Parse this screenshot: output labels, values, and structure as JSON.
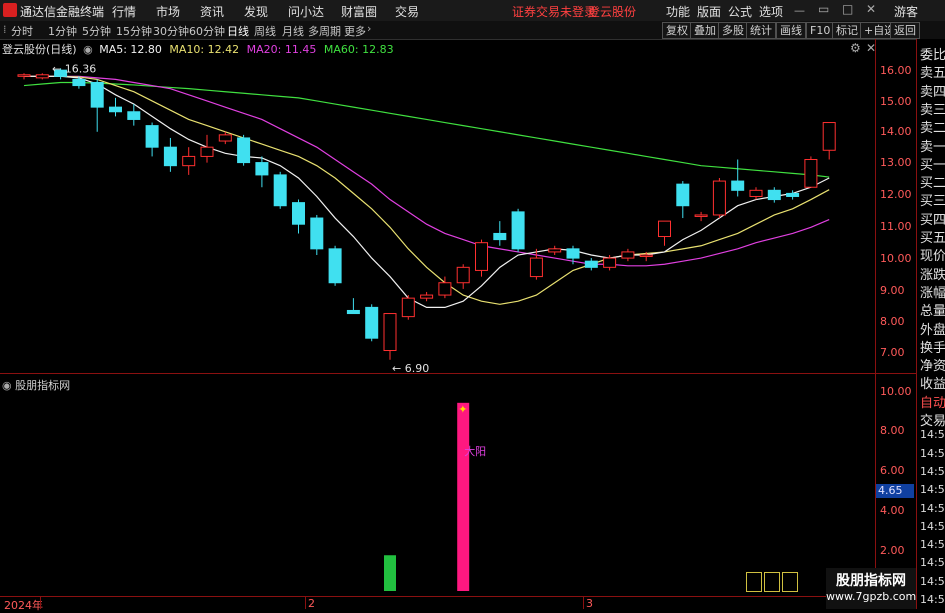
{
  "app": {
    "title": "通达信金融终端",
    "menu": [
      "行情",
      "市场",
      "资讯",
      "发现",
      "问小达",
      "财富圈",
      "交易"
    ],
    "trade_status": "证券交易未登录",
    "stock_name_red": "登云股份",
    "right_menu": [
      "功能",
      "版面",
      "公式",
      "选项"
    ],
    "guest": "游客"
  },
  "toolbar": {
    "periods": [
      "分时",
      "1分钟",
      "5分钟",
      "15分钟",
      "30分钟",
      "60分钟",
      "日线",
      "周线",
      "月线",
      "多周期",
      "更多"
    ],
    "active_period": "日线",
    "buttons": [
      "复权",
      "叠加",
      "多股",
      "统计",
      "画线",
      "F10",
      "标记",
      "+自选",
      "返回"
    ]
  },
  "chart": {
    "title": "登云股份(日线)",
    "ma_legend": [
      {
        "label": "MA5: 12.80",
        "color": "#f0f0f0"
      },
      {
        "label": "MA10: 12.42",
        "color": "#e8e070"
      },
      {
        "label": "MA20: 11.45",
        "color": "#e040e0"
      },
      {
        "label": "MA60: 12.83",
        "color": "#40e040"
      }
    ],
    "high_label": "16.36",
    "low_label": "6.90",
    "price_ticks": [
      "16.00",
      "15.00",
      "14.00",
      "13.00",
      "12.00",
      "11.00",
      "10.00",
      "9.00",
      "8.00",
      "7.00"
    ],
    "colors": {
      "up": "#ff3030",
      "down": "#40e0f0",
      "ma5": "#f0f0f0",
      "ma10": "#e8e070",
      "ma20": "#e040e0",
      "ma60": "#40e040"
    }
  },
  "indicator": {
    "title": "股朋指标网",
    "signal_text": "大阳",
    "scale_ticks": [
      "10.00",
      "8.00",
      "6.00",
      "4.00",
      "2.00"
    ],
    "current_value": "4.65"
  },
  "xaxis": {
    "labels": [
      "2024年",
      "2",
      "3"
    ]
  },
  "right_panel": {
    "items": [
      "委比",
      "卖五",
      "卖四",
      "卖三",
      "卖二",
      "卖一",
      "买一",
      "买二",
      "买三",
      "买四",
      "买五",
      "现价",
      "涨跌",
      "涨幅",
      "总量",
      "外盘",
      "换手",
      "净资",
      "收益",
      "自动",
      "交易",
      "14:55",
      "14:56",
      "14:56",
      "14:56",
      "14:56",
      "14:56",
      "14:56",
      "14:56",
      "14:56",
      "14:56"
    ]
  },
  "watermark": {
    "line1": "股朋指标网",
    "line2": "www.7gpzb.com"
  },
  "chart_data": {
    "type": "candlestick",
    "title": "登云股份(日线)",
    "ylim": [
      6.6,
      16.5
    ],
    "candles": [
      {
        "o": 16.1,
        "c": 16.15,
        "h": 16.2,
        "l": 16.0
      },
      {
        "o": 16.05,
        "c": 16.15,
        "h": 16.2,
        "l": 16.0
      },
      {
        "o": 16.3,
        "c": 16.1,
        "h": 16.36,
        "l": 16.0
      },
      {
        "o": 16.0,
        "c": 15.8,
        "h": 16.1,
        "l": 15.7
      },
      {
        "o": 15.9,
        "c": 15.1,
        "h": 16.0,
        "l": 14.3
      },
      {
        "o": 15.1,
        "c": 14.95,
        "h": 15.4,
        "l": 14.8
      },
      {
        "o": 14.95,
        "c": 14.7,
        "h": 15.2,
        "l": 14.5
      },
      {
        "o": 14.5,
        "c": 13.8,
        "h": 14.6,
        "l": 13.5
      },
      {
        "o": 13.8,
        "c": 13.2,
        "h": 14.1,
        "l": 13.0
      },
      {
        "o": 13.2,
        "c": 13.5,
        "h": 13.8,
        "l": 12.9
      },
      {
        "o": 13.5,
        "c": 13.8,
        "h": 14.2,
        "l": 13.3
      },
      {
        "o": 14.0,
        "c": 14.2,
        "h": 14.3,
        "l": 13.9
      },
      {
        "o": 14.1,
        "c": 13.3,
        "h": 14.2,
        "l": 13.2
      },
      {
        "o": 13.3,
        "c": 12.9,
        "h": 13.5,
        "l": 12.5
      },
      {
        "o": 12.9,
        "c": 11.9,
        "h": 13.0,
        "l": 11.8
      },
      {
        "o": 12.0,
        "c": 11.3,
        "h": 12.1,
        "l": 11.0
      },
      {
        "o": 11.5,
        "c": 10.5,
        "h": 11.6,
        "l": 10.3
      },
      {
        "o": 10.5,
        "c": 9.4,
        "h": 10.6,
        "l": 9.3
      },
      {
        "o": 8.5,
        "c": 8.4,
        "h": 8.9,
        "l": 8.4
      },
      {
        "o": 8.6,
        "c": 7.6,
        "h": 8.7,
        "l": 7.5
      },
      {
        "o": 7.2,
        "c": 8.4,
        "h": 8.4,
        "l": 6.9
      },
      {
        "o": 8.3,
        "c": 8.9,
        "h": 9.0,
        "l": 8.2
      },
      {
        "o": 8.9,
        "c": 9.0,
        "h": 9.1,
        "l": 8.8
      },
      {
        "o": 9.0,
        "c": 9.4,
        "h": 9.6,
        "l": 8.9
      },
      {
        "o": 9.4,
        "c": 9.9,
        "h": 10.0,
        "l": 9.2
      },
      {
        "o": 9.8,
        "c": 10.7,
        "h": 10.8,
        "l": 9.6
      },
      {
        "o": 11.0,
        "c": 10.8,
        "h": 11.4,
        "l": 10.6
      },
      {
        "o": 11.7,
        "c": 10.5,
        "h": 11.8,
        "l": 10.4
      },
      {
        "o": 9.6,
        "c": 10.2,
        "h": 10.5,
        "l": 9.5
      },
      {
        "o": 10.4,
        "c": 10.5,
        "h": 10.6,
        "l": 10.3
      },
      {
        "o": 10.5,
        "c": 10.2,
        "h": 10.6,
        "l": 10.0
      },
      {
        "o": 10.1,
        "c": 9.9,
        "h": 10.2,
        "l": 9.8
      },
      {
        "o": 9.9,
        "c": 10.2,
        "h": 10.3,
        "l": 9.8
      },
      {
        "o": 10.2,
        "c": 10.4,
        "h": 10.5,
        "l": 10.1
      },
      {
        "o": 10.3,
        "c": 10.3,
        "h": 10.4,
        "l": 10.1
      },
      {
        "o": 10.9,
        "c": 11.4,
        "h": 11.4,
        "l": 10.6
      },
      {
        "o": 12.6,
        "c": 11.9,
        "h": 12.7,
        "l": 11.5
      },
      {
        "o": 11.6,
        "c": 11.6,
        "h": 11.7,
        "l": 11.4
      },
      {
        "o": 11.6,
        "c": 12.7,
        "h": 12.8,
        "l": 11.5
      },
      {
        "o": 12.7,
        "c": 12.4,
        "h": 13.4,
        "l": 12.2
      },
      {
        "o": 12.2,
        "c": 12.4,
        "h": 12.5,
        "l": 12.1
      },
      {
        "o": 12.4,
        "c": 12.1,
        "h": 12.5,
        "l": 12.0
      },
      {
        "o": 12.3,
        "c": 12.2,
        "h": 12.4,
        "l": 12.1
      },
      {
        "o": 12.5,
        "c": 13.4,
        "h": 13.5,
        "l": 12.5
      },
      {
        "o": 13.7,
        "c": 14.6,
        "h": 14.6,
        "l": 13.4
      }
    ],
    "ma5": [
      16.1,
      16.1,
      16.1,
      16.05,
      15.85,
      15.5,
      15.2,
      14.8,
      14.4,
      14.05,
      13.8,
      13.6,
      13.5,
      13.45,
      13.2,
      12.8,
      12.2,
      11.5,
      10.9,
      10.2,
      9.6,
      8.9,
      8.6,
      8.6,
      8.8,
      9.3,
      9.9,
      10.3,
      10.4,
      10.5,
      10.45,
      10.3,
      10.2,
      10.3,
      10.3,
      10.4,
      10.8,
      11.1,
      11.5,
      11.9,
      12.1,
      12.2,
      12.3,
      12.5,
      12.8
    ],
    "ma10": [
      16.1,
      16.1,
      16.1,
      16.08,
      16.0,
      15.8,
      15.6,
      15.3,
      15.0,
      14.7,
      14.5,
      14.3,
      14.1,
      13.9,
      13.7,
      13.5,
      13.2,
      12.8,
      12.3,
      11.8,
      11.2,
      10.5,
      9.9,
      9.4,
      9.0,
      8.8,
      8.7,
      8.8,
      9.0,
      9.4,
      9.8,
      10.0,
      10.2,
      10.3,
      10.35,
      10.4,
      10.5,
      10.6,
      10.8,
      11.0,
      11.3,
      11.6,
      11.8,
      12.1,
      12.42
    ],
    "ma20": [
      16.1,
      16.1,
      16.1,
      16.1,
      16.05,
      16.0,
      15.9,
      15.8,
      15.7,
      15.5,
      15.3,
      15.1,
      14.9,
      14.7,
      14.4,
      14.1,
      13.8,
      13.4,
      13.0,
      12.6,
      12.1,
      11.7,
      11.3,
      11.0,
      10.8,
      10.6,
      10.5,
      10.4,
      10.3,
      10.2,
      10.1,
      10.0,
      10.0,
      9.95,
      9.95,
      10.0,
      10.1,
      10.2,
      10.35,
      10.5,
      10.7,
      10.85,
      11.0,
      11.2,
      11.45
    ],
    "ma60": [
      15.8,
      15.85,
      15.9,
      15.9,
      15.88,
      15.85,
      15.82,
      15.78,
      15.74,
      15.7,
      15.65,
      15.6,
      15.55,
      15.5,
      15.45,
      15.4,
      15.3,
      15.2,
      15.1,
      15.0,
      14.9,
      14.8,
      14.7,
      14.6,
      14.5,
      14.4,
      14.3,
      14.2,
      14.1,
      14.0,
      13.9,
      13.8,
      13.7,
      13.6,
      13.5,
      13.4,
      13.3,
      13.2,
      13.15,
      13.1,
      13.05,
      13.0,
      12.95,
      12.9,
      12.83
    ],
    "indicator_bars": [
      {
        "index": 20,
        "value": 1.9,
        "color": "#22c040"
      },
      {
        "index": 24,
        "value": 10.0,
        "color": "#ff1880"
      }
    ],
    "indicator_ylim": [
      0,
      11
    ]
  }
}
